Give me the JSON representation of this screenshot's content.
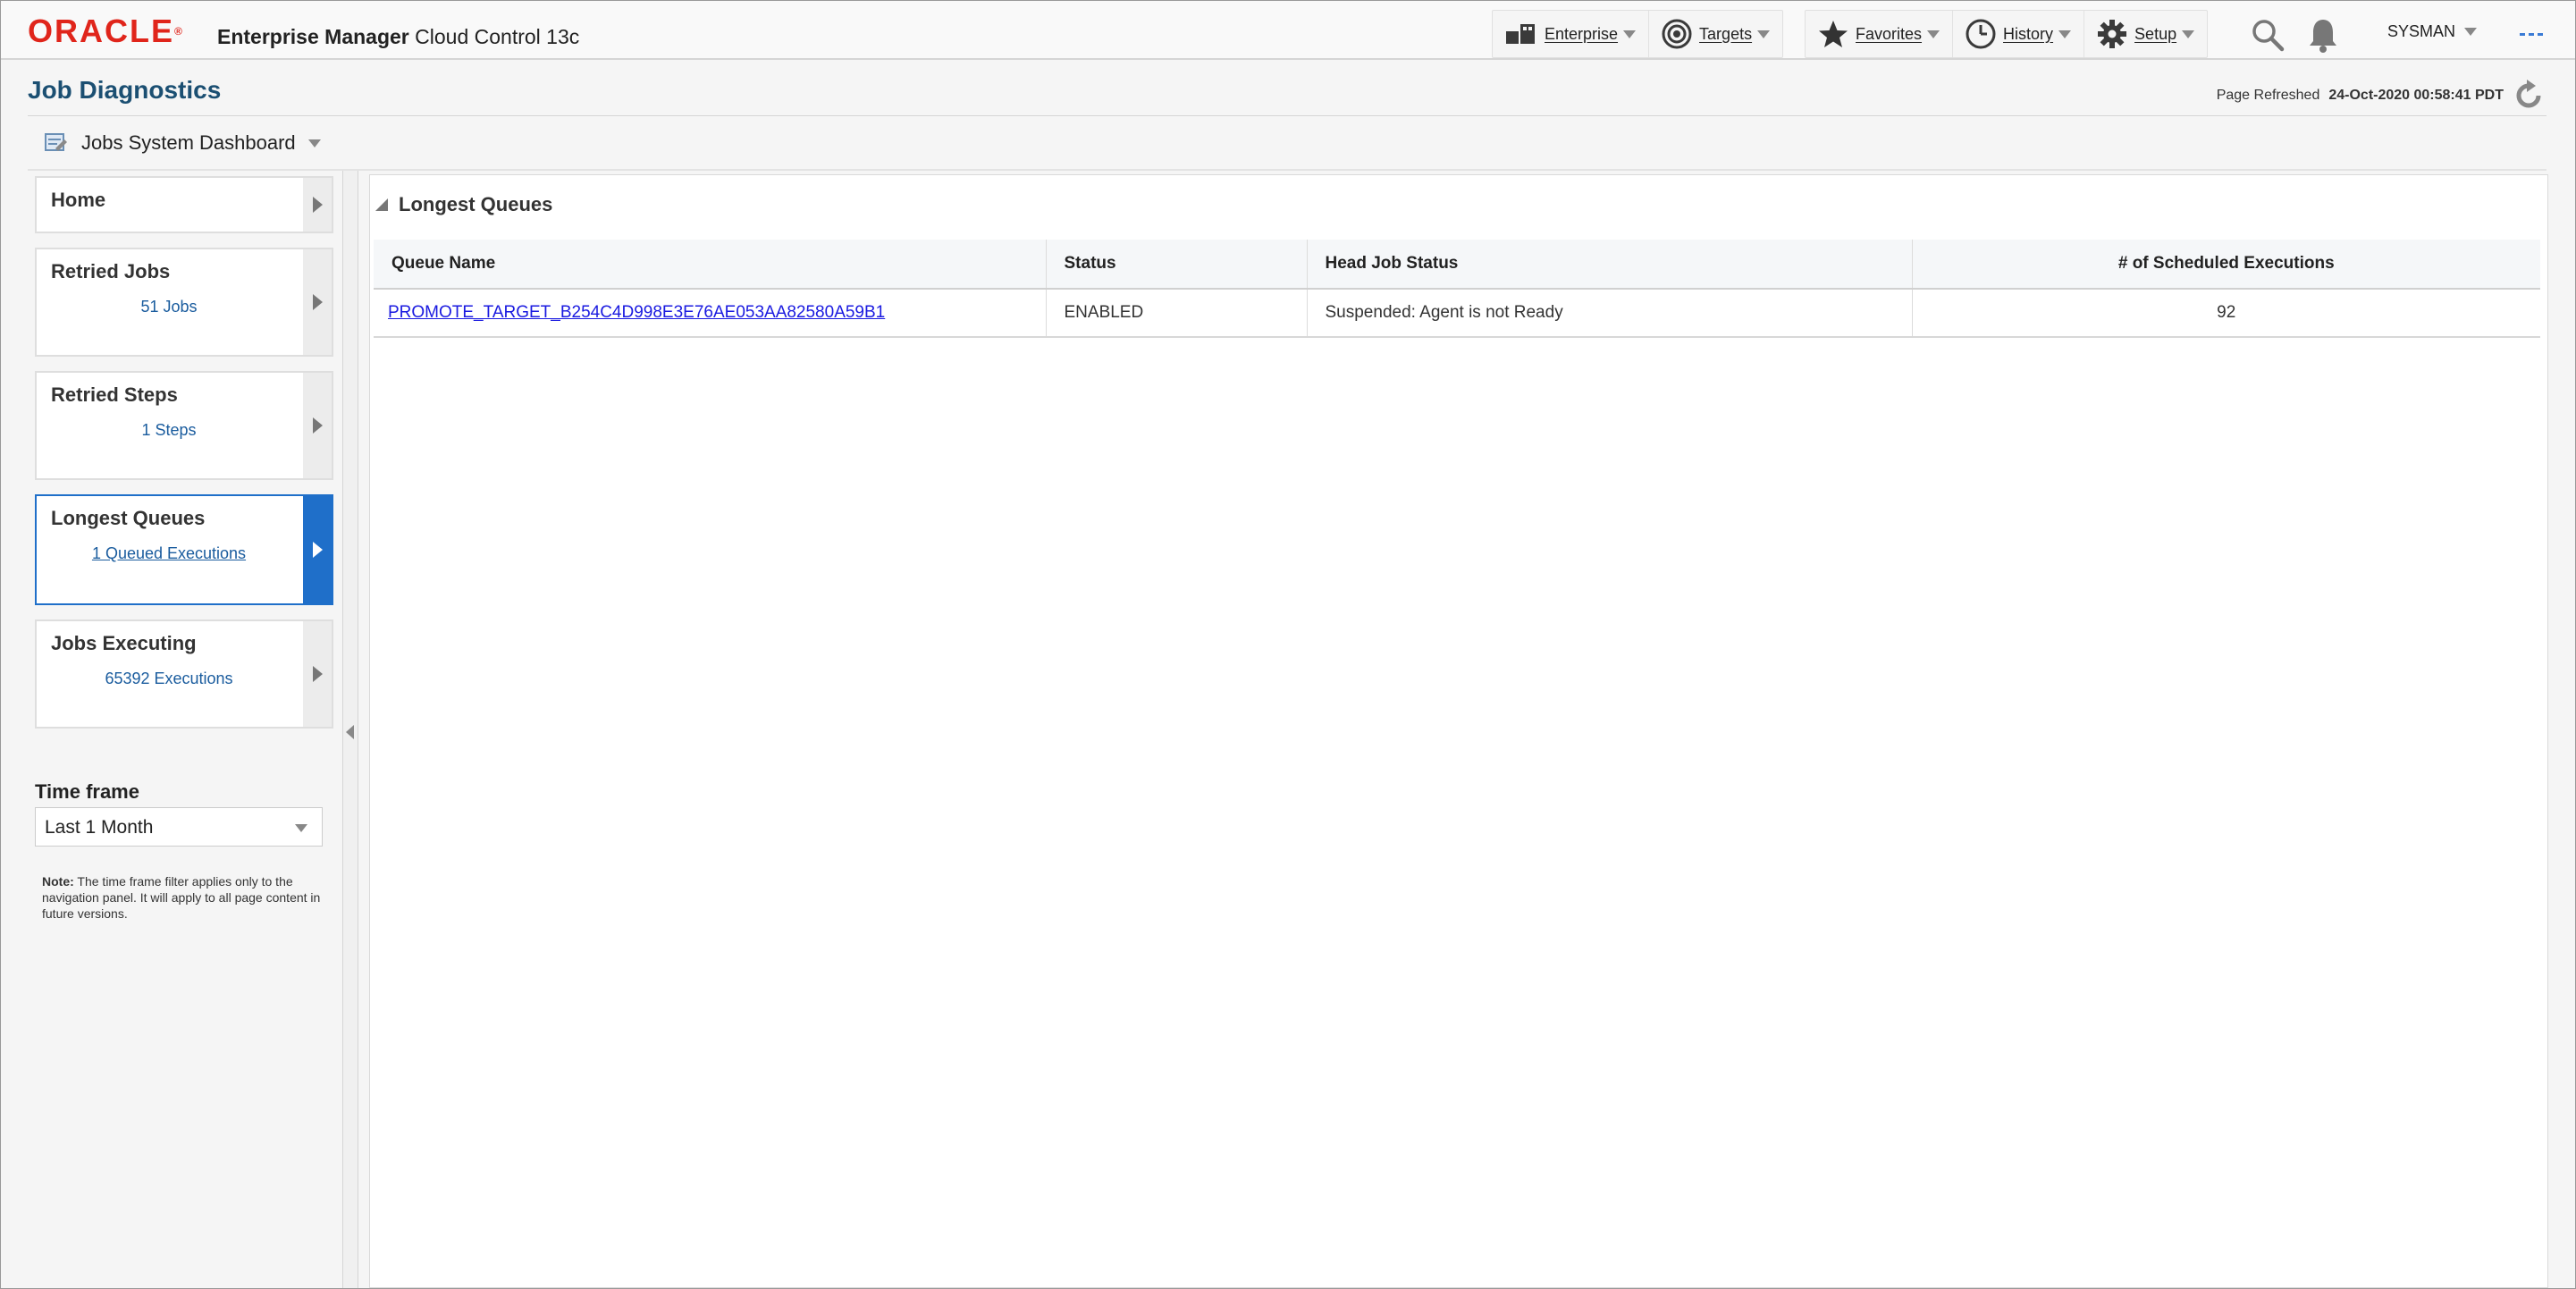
{
  "header": {
    "logo_text": "ORACLE",
    "product_bold": "Enterprise Manager",
    "product_rest": "Cloud Control 13c",
    "nav": [
      {
        "label": "Enterprise",
        "icon": "enterprise-icon"
      },
      {
        "label": "Targets",
        "icon": "targets-icon"
      },
      {
        "label": "Favorites",
        "icon": "star-icon"
      },
      {
        "label": "History",
        "icon": "clock-icon"
      },
      {
        "label": "Setup",
        "icon": "gear-icon"
      }
    ],
    "user": "SYSMAN"
  },
  "page": {
    "title": "Job Diagnostics",
    "refreshed_label": "Page Refreshed",
    "refreshed_value": "24-Oct-2020 00:58:41 PDT",
    "dashboard_selector": "Jobs System Dashboard"
  },
  "sidebar": {
    "cards": [
      {
        "title": "Home",
        "subtitle": ""
      },
      {
        "title": "Retried Jobs",
        "subtitle": "51 Jobs"
      },
      {
        "title": "Retried Steps",
        "subtitle": "1 Steps"
      },
      {
        "title": "Longest Queues",
        "subtitle": "1 Queued Executions"
      },
      {
        "title": "Jobs Executing",
        "subtitle": "65392 Executions"
      }
    ],
    "timeframe_label": "Time frame",
    "timeframe_value": "Last 1 Month",
    "note_label": "Note:",
    "note_text": "The time frame filter applies only to the navigation panel. It will apply to all page content in future versions."
  },
  "main": {
    "section_title": "Longest Queues",
    "table": {
      "columns": [
        "Queue Name",
        "Status",
        "Head Job Status",
        "# of Scheduled Executions"
      ],
      "rows": [
        [
          "PROMOTE_TARGET_B254C4D998E3E76AE053AA82580A59B1",
          "ENABLED",
          "Suspended: Agent is not Ready",
          "92"
        ]
      ]
    }
  },
  "colors": {
    "brand_red": "#e0251b",
    "accent_blue": "#1f6fc9",
    "title_blue": "#1b4f72",
    "link_blue": "#1a5c9e"
  }
}
